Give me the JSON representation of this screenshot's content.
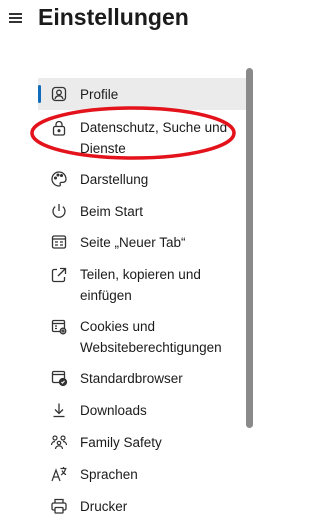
{
  "header": {
    "title": "Einstellungen"
  },
  "nav": {
    "items": [
      {
        "label": "Profile",
        "icon": "profile-icon",
        "active": true
      },
      {
        "label": "Datenschutz, Suche und Dienste",
        "icon": "lock-icon"
      },
      {
        "label": "Darstellung",
        "icon": "palette-icon"
      },
      {
        "label": "Beim Start",
        "icon": "power-icon"
      },
      {
        "label": "Seite „Neuer Tab“",
        "icon": "new-tab-page-icon"
      },
      {
        "label": "Teilen, kopieren und einfügen",
        "icon": "share-icon"
      },
      {
        "label": "Cookies und Websiteberechtigungen",
        "icon": "site-permissions-icon"
      },
      {
        "label": "Standardbrowser",
        "icon": "default-browser-icon"
      },
      {
        "label": "Downloads",
        "icon": "download-icon"
      },
      {
        "label": "Family Safety",
        "icon": "family-icon"
      },
      {
        "label": "Sprachen",
        "icon": "language-icon"
      },
      {
        "label": "Drucker",
        "icon": "printer-icon"
      }
    ]
  },
  "colors": {
    "accent": "#0f6cbd",
    "highlight_ring": "#e3121b",
    "active_bg": "#ebebeb"
  }
}
